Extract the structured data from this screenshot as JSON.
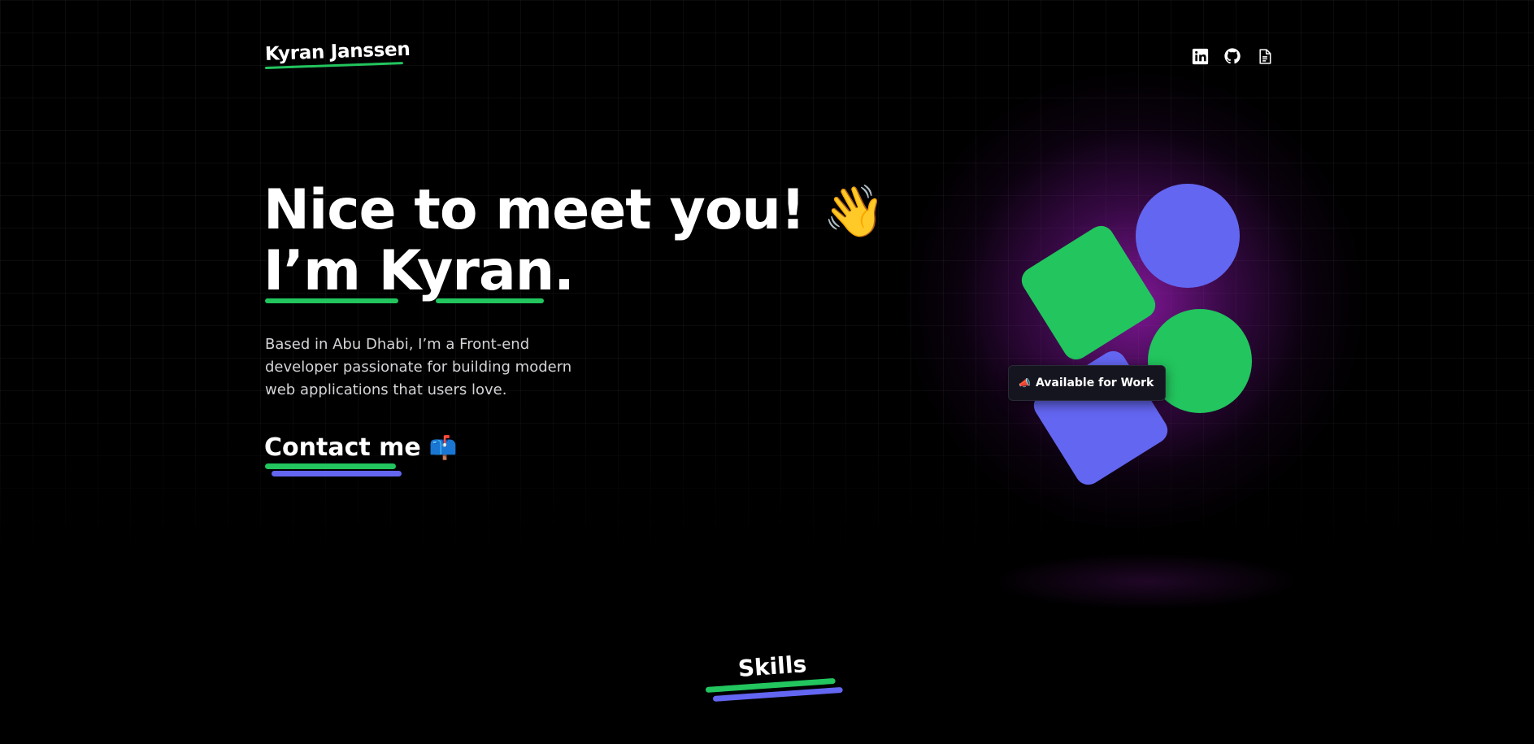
{
  "header": {
    "logo_text": "Kyran Janssen",
    "social_links": [
      {
        "name": "linkedin-icon",
        "label": "LinkedIn"
      },
      {
        "name": "github-icon",
        "label": "GitHub"
      },
      {
        "name": "resume-icon",
        "label": "Resume"
      }
    ]
  },
  "hero": {
    "title_line1": "Nice to meet you!",
    "wave_emoji": "👋",
    "title_line2": "I’m Kyran.",
    "bio": "Based in Abu Dhabi, I’m a Front-end developer passionate for building modern web applications that users love.",
    "contact_label": "Contact me",
    "mailbox_emoji": "📫",
    "status_badge_icon": "📣",
    "status_badge_text": "Available for Work"
  },
  "skills": {
    "title": "Skills"
  },
  "colors": {
    "background": "#000000",
    "accent_green": "#22c55e",
    "accent_indigo": "#6366f1",
    "glow_purple": "#a21caf",
    "text": "#ffffff",
    "muted_text": "#d4d4d8"
  }
}
